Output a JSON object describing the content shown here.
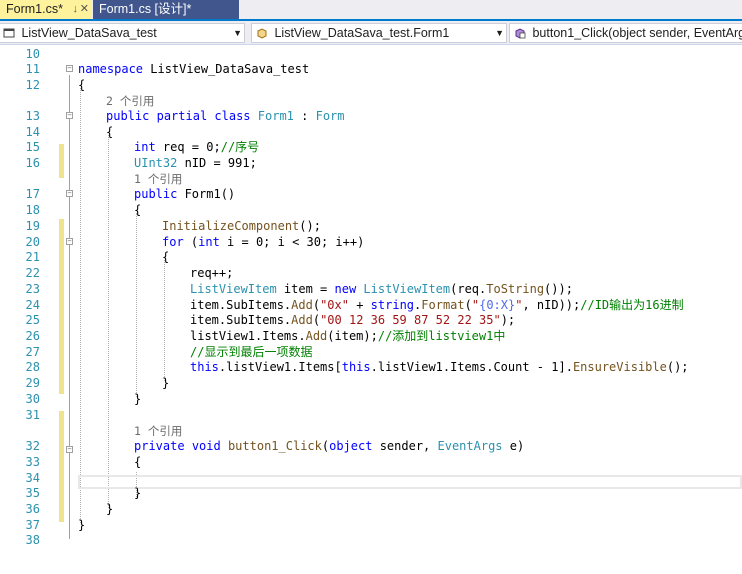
{
  "tabs": [
    {
      "label": "Form1.cs*",
      "active": true
    },
    {
      "label": "Form1.cs [设计]*",
      "active": false
    }
  ],
  "navbar": {
    "project": "ListView_DataSava_test",
    "type": "ListView_DataSava_test.Form1",
    "member": "button1_Click(object sender, EventArgs e)"
  },
  "editor": {
    "line_numbers": [
      "10",
      "11",
      "12",
      "13",
      "14",
      "15",
      "16",
      "17",
      "18",
      "19",
      "20",
      "21",
      "22",
      "23",
      "24",
      "25",
      "26",
      "27",
      "28",
      "29",
      "30",
      "31",
      "32",
      "33",
      "34",
      "35",
      "36",
      "37",
      "38"
    ],
    "codelens": [
      "2 个引用",
      "1 个引用",
      "1 个引用"
    ],
    "code": {
      "namespace_kw": "namespace",
      "namespace_name": " ListView_DataSava_test",
      "brace_open": "{",
      "brace_close": "}",
      "public": "public",
      "partial": "partial",
      "class": "class",
      "form1": "Form1",
      "colon": ":",
      "form": "Form",
      "int": "int",
      "req_decl": " req = 0;",
      "req_comment": "//序号",
      "uint32": "UInt32",
      "nid_decl": " nID = 991;",
      "ctor_name": " Form1()",
      "init_call": "InitializeComponent",
      "init_tail": "();",
      "for_kw": "for",
      "for_open": " (",
      "for_tail": " i = 0; i < 30; i++)",
      "req_inc": "req++;",
      "listviewitem": "ListViewItem",
      "item_eq": " item = ",
      "new_kw": "new",
      "req_tostring_a": "(req.",
      "tostring": "ToString",
      "req_tostring_b": "());",
      "subitems1": "item.SubItems.",
      "add": "Add",
      "paren_open": "(",
      "str_0x": "\"0x\"",
      "plus": " + ",
      "string_kw": "string",
      "dot": ".",
      "format": "Format",
      "str_fmt_a": "\"",
      "str_fmt_b": "{0:X}",
      "str_fmt_c": "\"",
      "nid_close": ", nID));",
      "comment_hex": "//ID输出为16进制",
      "str_bytes": "\"00 12 36 59 87 52 22 35\"",
      "close_semi": ");",
      "listview_items": "listView1.Items.",
      "item_arg": "(item);",
      "comment_add": "//添加到listview1中",
      "comment_show": "//显示到最后一项数据",
      "this_kw": "this",
      "items_a": ".listView1.Items[",
      "items_b": ".listView1.Items.Count - 1].",
      "ensurevisible": "EnsureVisible",
      "ev_tail": "();",
      "private": "private",
      "void": "void",
      "btn_name": "button1_Click",
      "object_kw": "object",
      "sender": " sender, ",
      "eventargs": "EventArgs",
      "e_close": " e)"
    }
  },
  "colors": {
    "keyword": "#0000ff",
    "type": "#2b91af",
    "string": "#a31515",
    "comment": "#008000",
    "method": "#74531f",
    "line_number": "#2b91af",
    "active_tab": "#fff29d",
    "inactive_tab": "#40568d",
    "tab_accent": "#007acc",
    "change_marker": "#efe38e"
  }
}
